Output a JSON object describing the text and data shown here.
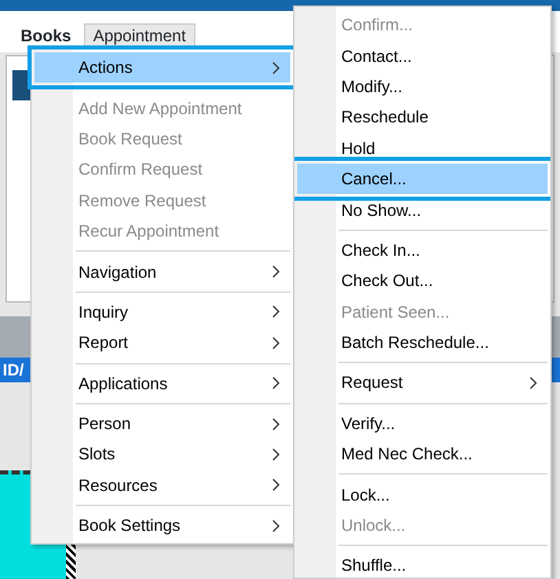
{
  "tabs": [
    {
      "label": "Books",
      "selected": true
    },
    {
      "label": "Appointment",
      "selected": false
    }
  ],
  "strip_label": "ID/",
  "menu": [
    {
      "kind": "item",
      "label": "Actions",
      "submenu": true,
      "disabled": false,
      "selected": true
    },
    {
      "kind": "separator"
    },
    {
      "kind": "item",
      "label": "Add New Appointment",
      "submenu": false,
      "disabled": true,
      "selected": false
    },
    {
      "kind": "item",
      "label": "Book Request",
      "submenu": false,
      "disabled": true,
      "selected": false
    },
    {
      "kind": "item",
      "label": "Confirm Request",
      "submenu": false,
      "disabled": true,
      "selected": false
    },
    {
      "kind": "item",
      "label": "Remove Request",
      "submenu": false,
      "disabled": true,
      "selected": false
    },
    {
      "kind": "item",
      "label": "Recur Appointment",
      "submenu": false,
      "disabled": true,
      "selected": false
    },
    {
      "kind": "separator"
    },
    {
      "kind": "item",
      "label": "Navigation",
      "submenu": true,
      "disabled": false,
      "selected": false
    },
    {
      "kind": "separator"
    },
    {
      "kind": "item",
      "label": "Inquiry",
      "submenu": true,
      "disabled": false,
      "selected": false
    },
    {
      "kind": "item",
      "label": "Report",
      "submenu": true,
      "disabled": false,
      "selected": false
    },
    {
      "kind": "separator"
    },
    {
      "kind": "item",
      "label": "Applications",
      "submenu": true,
      "disabled": false,
      "selected": false
    },
    {
      "kind": "separator"
    },
    {
      "kind": "item",
      "label": "Person",
      "submenu": true,
      "disabled": false,
      "selected": false
    },
    {
      "kind": "item",
      "label": "Slots",
      "submenu": true,
      "disabled": false,
      "selected": false
    },
    {
      "kind": "item",
      "label": "Resources",
      "submenu": true,
      "disabled": false,
      "selected": false
    },
    {
      "kind": "separator"
    },
    {
      "kind": "item",
      "label": "Book Settings",
      "submenu": true,
      "disabled": false,
      "selected": false
    }
  ],
  "submenu": [
    {
      "kind": "item",
      "label": "Confirm...",
      "submenu": false,
      "disabled": true,
      "selected": false
    },
    {
      "kind": "item",
      "label": "Contact...",
      "submenu": false,
      "disabled": false,
      "selected": false
    },
    {
      "kind": "item",
      "label": "Modify...",
      "submenu": false,
      "disabled": false,
      "selected": false
    },
    {
      "kind": "item",
      "label": "Reschedule",
      "submenu": false,
      "disabled": false,
      "selected": false
    },
    {
      "kind": "item",
      "label": "Hold",
      "submenu": false,
      "disabled": false,
      "selected": false
    },
    {
      "kind": "item",
      "label": "Cancel...",
      "submenu": false,
      "disabled": false,
      "selected": true
    },
    {
      "kind": "item",
      "label": "No Show...",
      "submenu": false,
      "disabled": false,
      "selected": false
    },
    {
      "kind": "separator"
    },
    {
      "kind": "item",
      "label": "Check In...",
      "submenu": false,
      "disabled": false,
      "selected": false
    },
    {
      "kind": "item",
      "label": "Check Out...",
      "submenu": false,
      "disabled": false,
      "selected": false
    },
    {
      "kind": "item",
      "label": "Patient Seen...",
      "submenu": false,
      "disabled": true,
      "selected": false
    },
    {
      "kind": "item",
      "label": "Batch Reschedule...",
      "submenu": false,
      "disabled": false,
      "selected": false
    },
    {
      "kind": "separator"
    },
    {
      "kind": "item",
      "label": "Request",
      "submenu": true,
      "disabled": false,
      "selected": false
    },
    {
      "kind": "separator"
    },
    {
      "kind": "item",
      "label": "Verify...",
      "submenu": false,
      "disabled": false,
      "selected": false
    },
    {
      "kind": "item",
      "label": "Med Nec Check...",
      "submenu": false,
      "disabled": false,
      "selected": false
    },
    {
      "kind": "separator"
    },
    {
      "kind": "item",
      "label": "Lock...",
      "submenu": false,
      "disabled": false,
      "selected": false
    },
    {
      "kind": "item",
      "label": "Unlock...",
      "submenu": false,
      "disabled": true,
      "selected": false
    },
    {
      "kind": "separator"
    },
    {
      "kind": "item",
      "label": "Shuffle...",
      "submenu": false,
      "disabled": false,
      "selected": false
    }
  ]
}
